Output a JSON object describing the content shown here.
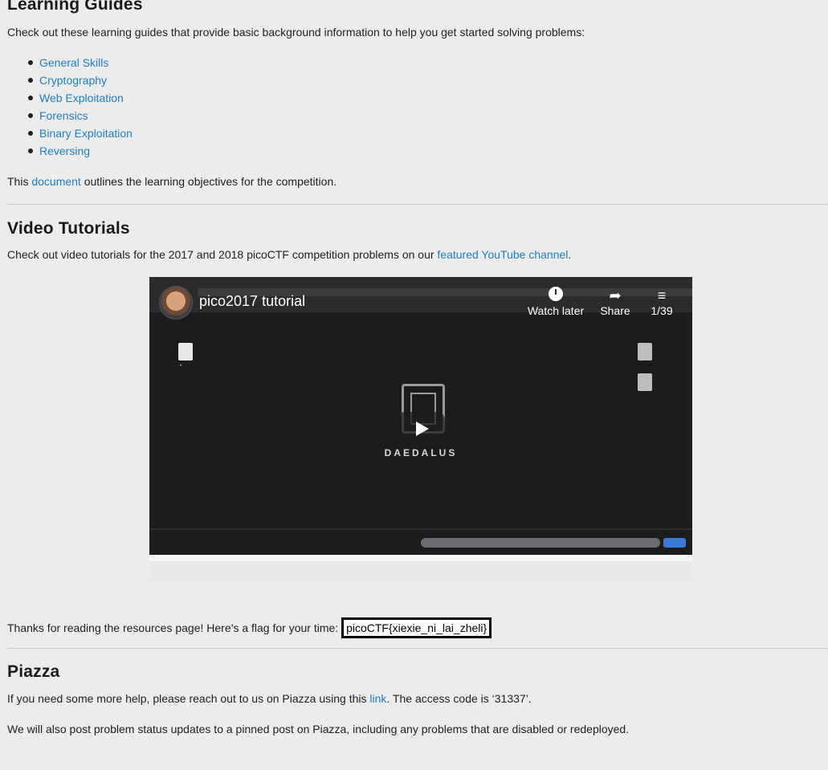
{
  "learning": {
    "heading": "Learning Guides",
    "intro": "Check out these learning guides that provide basic background information to help you get started solving problems:",
    "guides": [
      "General Skills",
      "Cryptography",
      "Web Exploitation",
      "Forensics",
      "Binary Exploitation",
      "Reversing"
    ],
    "doc_prefix": "This ",
    "doc_link": "document",
    "doc_suffix": " outlines the learning objectives for the competition."
  },
  "video_section": {
    "heading": "Video Tutorials",
    "text_prefix": "Check out video tutorials for the 2017 and 2018 picoCTF competition problems on our ",
    "link": "featured YouTube channel",
    "text_suffix": ".",
    "player": {
      "title": "pico2017 tutorial",
      "watch_later": "Watch later",
      "share": "Share",
      "count": "1/39",
      "brand": "DAEDALUS",
      "icons": [
        "clock-icon",
        "share-arrow-icon",
        "playlist-icon",
        "play-icon"
      ]
    }
  },
  "flag": {
    "prefix": "Thanks for reading the resources page! Here’s a flag for your time: ",
    "value": "picoCTF{xiexie_ni_lai_zheli}"
  },
  "piazza": {
    "heading": "Piazza",
    "p1_prefix": "If you need some more help, please reach out to us on Piazza using this ",
    "p1_link": "link",
    "p1_suffix": ". The access code is ‘31337’.",
    "p2": "We will also post problem status updates to a pinned post on Piazza, including any problems that are disabled or redeployed."
  },
  "colors": {
    "link": "#1e7ec8",
    "background": "#ececec",
    "text": "#212121"
  }
}
